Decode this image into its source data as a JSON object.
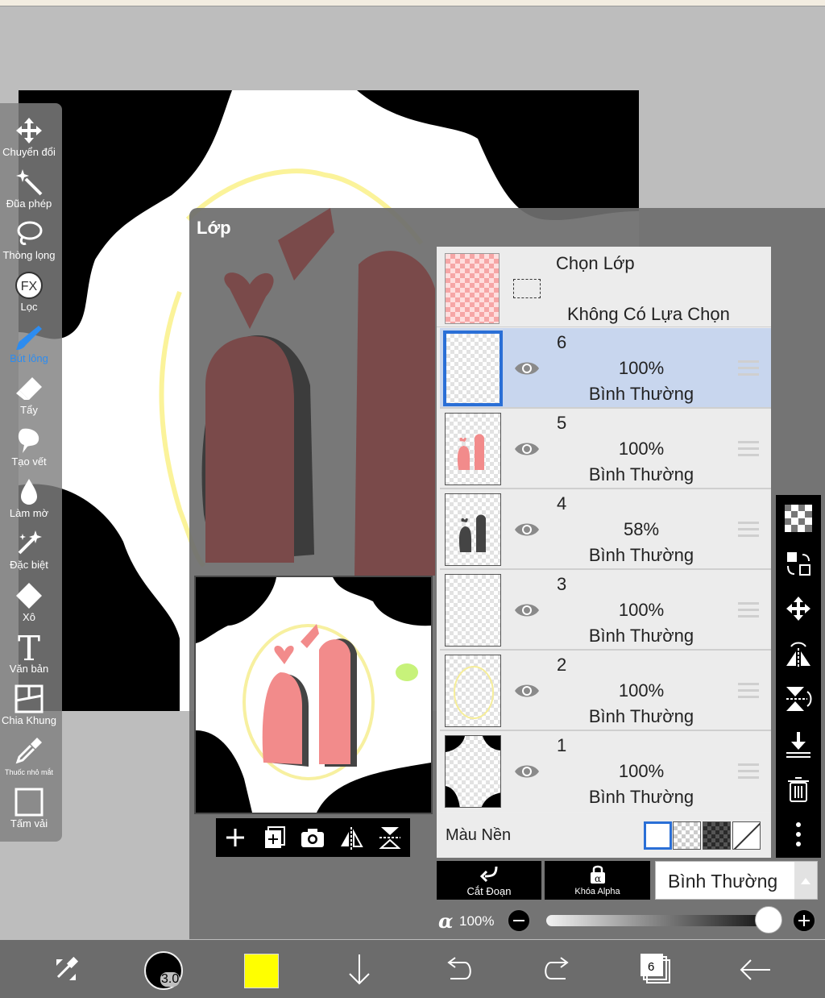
{
  "toolbar": {
    "tools": [
      {
        "label": "Chuyển đổi",
        "icon": "move-icon"
      },
      {
        "label": "Đũa phép",
        "icon": "magic-wand-icon"
      },
      {
        "label": "Thòng lọng",
        "icon": "lasso-icon"
      },
      {
        "label": "Lọc",
        "icon": "fx-filter-icon"
      },
      {
        "label": "Bút lông",
        "icon": "brush-icon",
        "active": true
      },
      {
        "label": "Tẩy",
        "icon": "eraser-icon"
      },
      {
        "label": "Tạo vết",
        "icon": "smudge-icon"
      },
      {
        "label": "Làm mờ",
        "icon": "blur-drop-icon"
      },
      {
        "label": "Đặc biệt",
        "icon": "special-sparkle-icon"
      },
      {
        "label": "Xô",
        "icon": "bucket-icon"
      },
      {
        "label": "Văn bản",
        "icon": "text-icon"
      },
      {
        "label": "Chia Khung",
        "icon": "frame-divider-icon"
      },
      {
        "label": "Thuốc nhỏ mắt",
        "icon": "eyedropper-icon"
      },
      {
        "label": "Tấm vải",
        "icon": "canvas-icon"
      }
    ]
  },
  "layer_panel": {
    "title": "Lớp",
    "selection": {
      "title": "Chọn Lớp",
      "status": "Không Có Lựa Chọn"
    },
    "layers": [
      {
        "number": "6",
        "opacity": "100%",
        "blend": "Bình Thường",
        "selected": true
      },
      {
        "number": "5",
        "opacity": "100%",
        "blend": "Bình Thường"
      },
      {
        "number": "4",
        "opacity": "58%",
        "blend": "Bình Thường"
      },
      {
        "number": "3",
        "opacity": "100%",
        "blend": "Bình Thường"
      },
      {
        "number": "2",
        "opacity": "100%",
        "blend": "Bình Thường"
      },
      {
        "number": "1",
        "opacity": "100%",
        "blend": "Bình Thường"
      }
    ],
    "background_label": "Màu Nền",
    "clipping_label": "Cắt Đoạn",
    "alpha_lock_label": "Khóa Alpha",
    "blend_mode": "Bình Thường",
    "alpha_symbol": "α",
    "alpha_value": "100%",
    "alpha_fraction": 1.0
  },
  "bottom_bar": {
    "brush_size": "3.0",
    "current_color": "#ffff00",
    "layer_count": "6"
  },
  "colors": {
    "accent": "#2d8cf0",
    "selected_layer": "#c8d6ee",
    "artwork_pink": "#f28b8b",
    "artwork_shadow": "#444444"
  }
}
